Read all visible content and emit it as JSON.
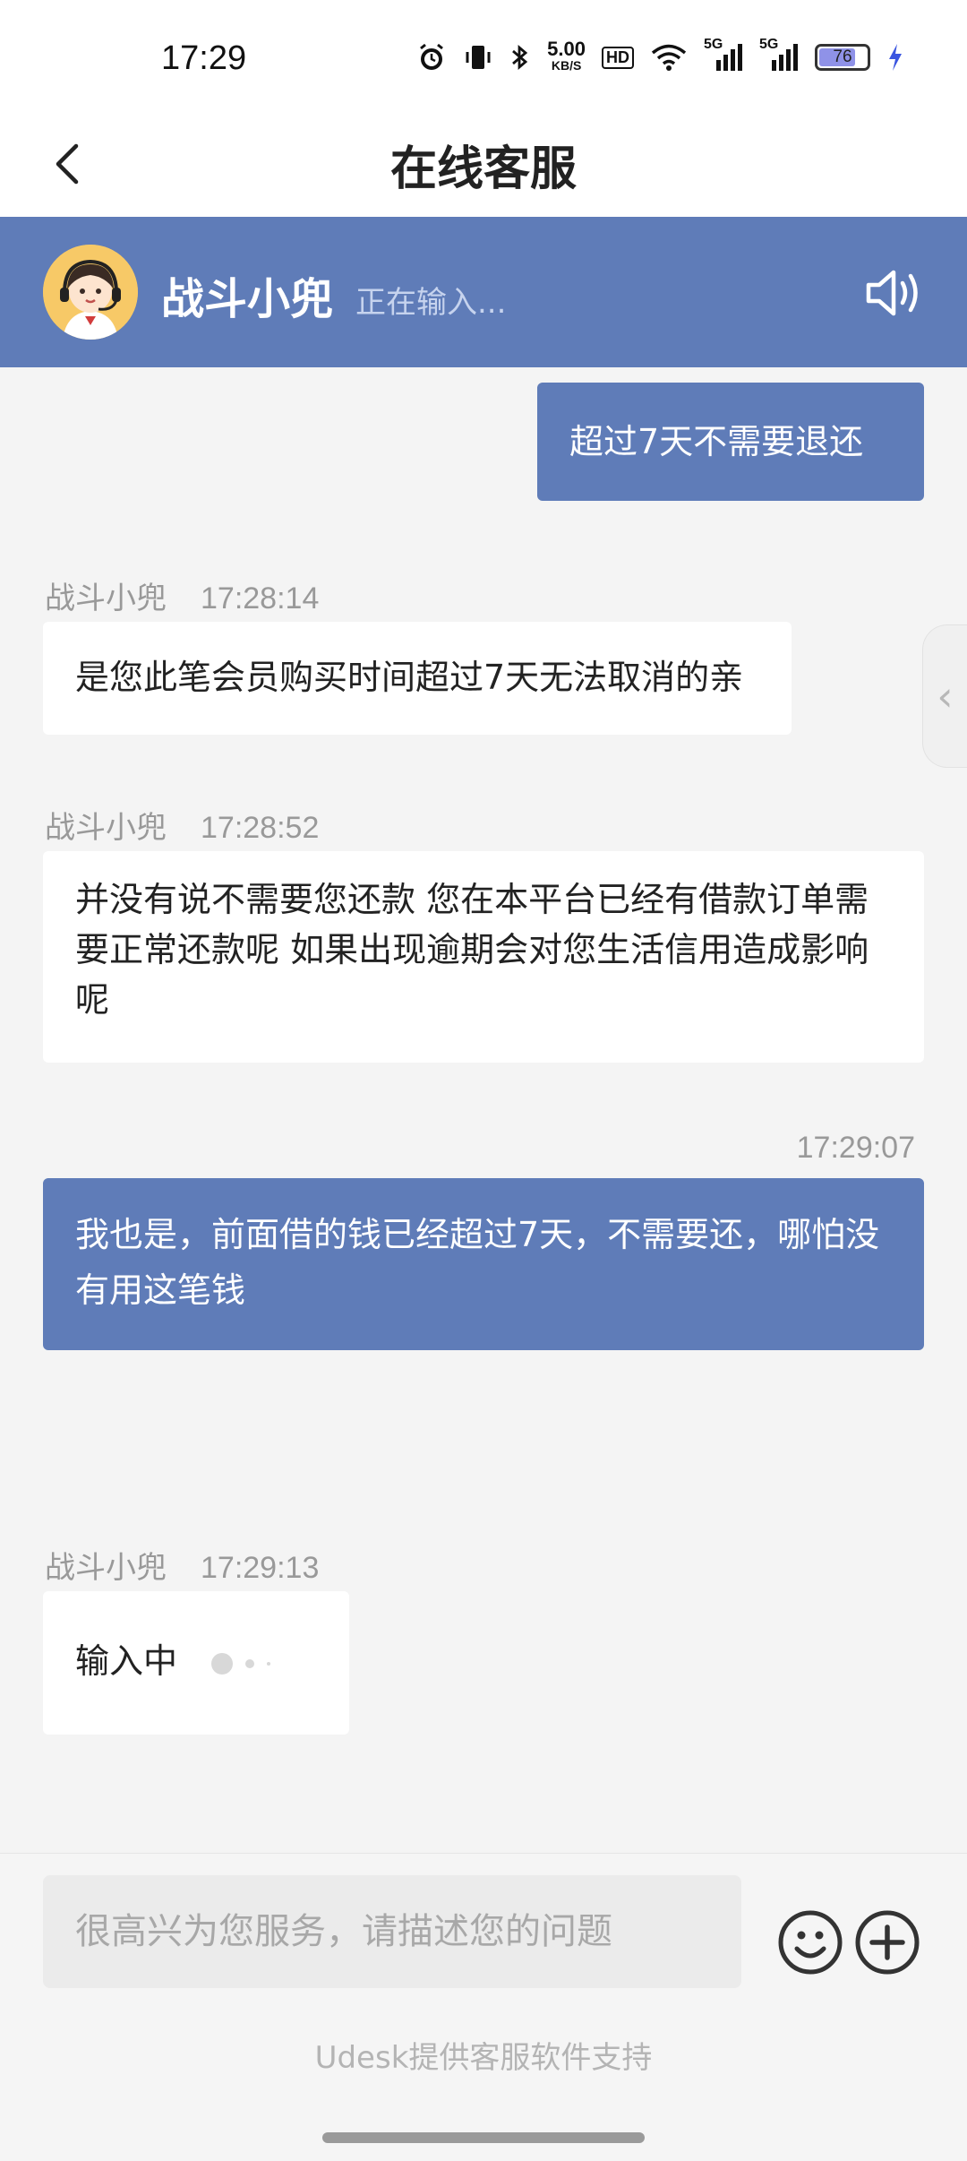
{
  "status_bar": {
    "time": "17:29",
    "net_speed_value": "5.00",
    "net_speed_unit": "KB/S",
    "hd_label": "HD",
    "signal1_label": "5G",
    "signal2_label": "5G",
    "battery_level": "76",
    "icons": [
      "alarm-icon",
      "vibrate-icon",
      "bluetooth-icon",
      "wifi-icon",
      "signal-icon",
      "battery-icon",
      "charging-icon"
    ]
  },
  "header": {
    "title": "在线客服"
  },
  "agent": {
    "name": "战斗小兜",
    "status": "正在输入..."
  },
  "messages": [
    {
      "side": "right",
      "text": "超过7天不需要退还"
    },
    {
      "side": "left",
      "sender": "战斗小兜",
      "time": "17:28:14",
      "text": "是您此笔会员购买时间超过7天无法取消的亲"
    },
    {
      "side": "left",
      "sender": "战斗小兜",
      "time": "17:28:52",
      "text": "并没有说不需要您还款 您在本平台已经有借款订单需要正常还款呢 如果出现逾期会对您生活信用造成影响呢"
    },
    {
      "side": "right",
      "time": "17:29:07",
      "text": "我也是，前面借的钱已经超过7天，不需要还，哪怕没有用这笔钱"
    },
    {
      "side": "left",
      "sender": "战斗小兜",
      "time": "17:29:13",
      "text": "输入中"
    }
  ],
  "input": {
    "placeholder": "很高兴为您服务，请描述您的问题",
    "value": ""
  },
  "footer": {
    "text": "Udesk提供客服软件支持"
  },
  "colors": {
    "accent": "#5f7cb8",
    "background": "#f4f4f4"
  }
}
